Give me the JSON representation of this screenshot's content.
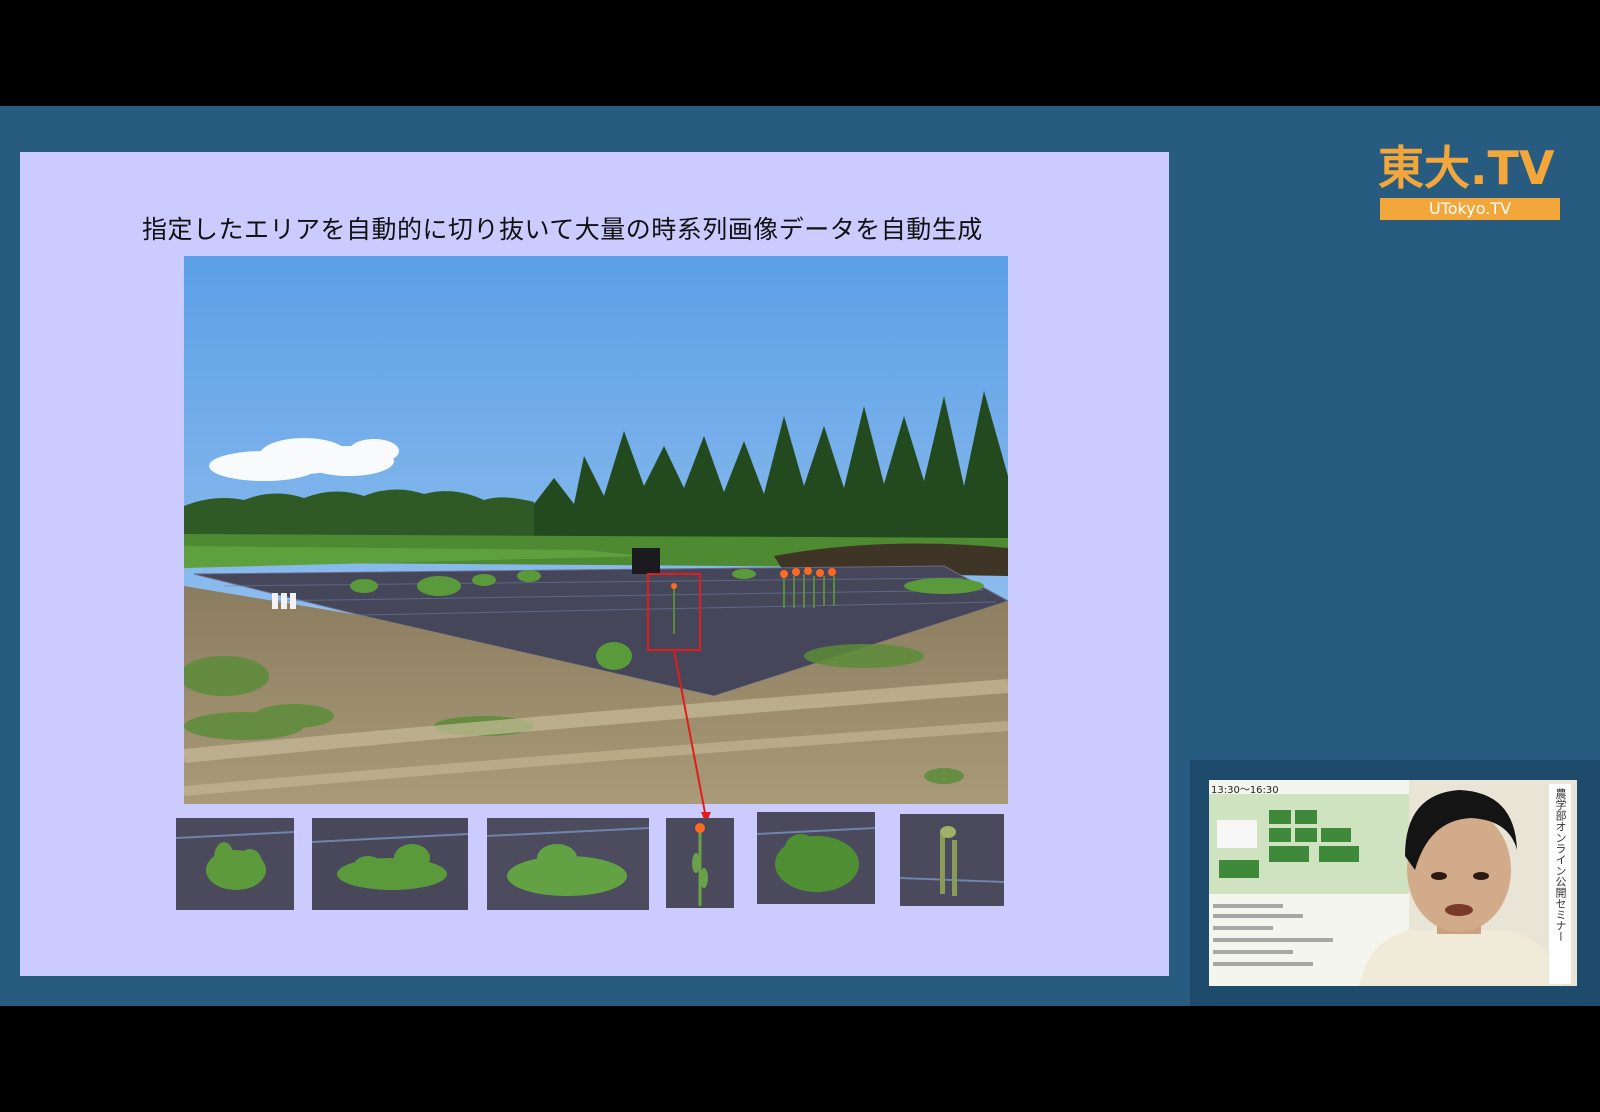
{
  "slide": {
    "title": "指定したエリアを自動的に切り抜いて大量の時系列画像データを自動生成",
    "main_image": "field-photo",
    "thumbnails": [
      "weed-thumb-1",
      "weed-thumb-2",
      "weed-thumb-3",
      "lily-thumb-4",
      "weed-thumb-5",
      "weed-thumb-6"
    ]
  },
  "logo": {
    "top": "東大.TV",
    "sub": "UTokyo.TV"
  },
  "webcam": {
    "poster_time": "13:30～16:30",
    "poster_vertical": "農学部オンライン公開セミナー"
  },
  "colors": {
    "stage": "#275b80",
    "slide": "#cbcbff",
    "logo": "#f3a73a",
    "highlight": "#e31b1b"
  }
}
